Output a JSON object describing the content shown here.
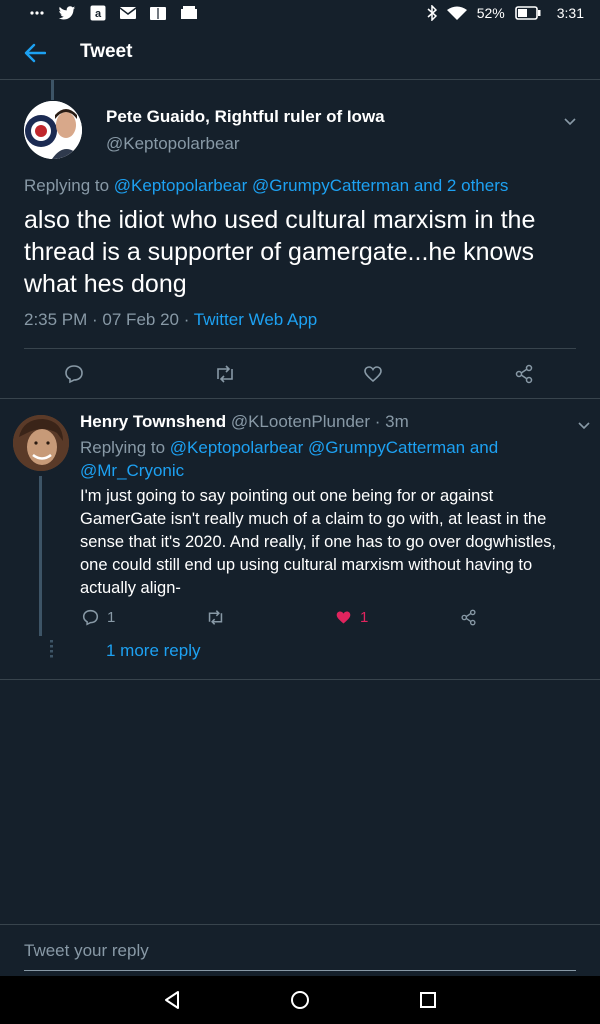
{
  "status_bar": {
    "battery": "52%",
    "time": "3:31",
    "left_icons": [
      "more-icon",
      "twitter-icon",
      "amazon-icon",
      "mail-icon",
      "kindle-icon",
      "store-icon"
    ],
    "right_icons": [
      "bluetooth-icon",
      "wifi-icon",
      "battery-icon"
    ]
  },
  "header": {
    "title": "Tweet",
    "back_icon": "back-arrow-icon"
  },
  "main_tweet": {
    "name": "Pete Guaido, Rightful ruler of Iowa",
    "handle": "@Keptopolarbear",
    "replying_prefix": "Replying to ",
    "replying_link1": "@Keptopolarbear",
    "replying_link2": "@GrumpyCatterman",
    "replying_suffix": "and 2 others",
    "text": "also the idiot who used cultural marxism in the thread is a supporter of gamergate...he knows what hes dong",
    "time": "2:35 PM",
    "date": "07 Feb 20",
    "source": "Twitter Web App",
    "actions": [
      "reply-icon",
      "retweet-icon",
      "like-icon",
      "share-icon"
    ]
  },
  "reply_tweet": {
    "name": "Henry Townshend",
    "handle": "@KLootenPlunder",
    "time_ago": "3m",
    "replying_prefix": "Replying to ",
    "replying_link1": "@Keptopolarbear",
    "replying_link2": "@GrumpyCatterman",
    "replying_and": "and",
    "replying_link3": "@Mr_Cryonic",
    "text": "I'm just going to say pointing out one being for or against GamerGate isn't really much of a claim to go with, at least in the sense that it's 2020. And really, if one has to go over dogwhistles, one could still end up using cultural marxism without having to actually align-",
    "reply_count": "1",
    "like_count": "1",
    "more_replies": "1 more reply"
  },
  "compose": {
    "placeholder": "Tweet your reply"
  },
  "colors": {
    "background": "#15202b",
    "accent": "#1da1f2",
    "muted": "#8899a6",
    "like": "#e0245e",
    "divider": "#38444d"
  }
}
